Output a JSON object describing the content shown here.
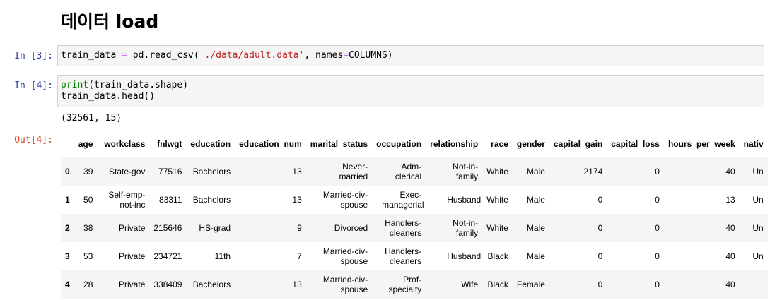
{
  "heading": "데이터 load",
  "cells": [
    {
      "prompt": "In [3]:",
      "code_parts": {
        "a": "train_data ",
        "eq": "=",
        "b": " pd.read_csv(",
        "str": "'./data/adult.data'",
        "c": ", names",
        "eq2": "=",
        "d": "COLUMNS)"
      }
    },
    {
      "prompt": "In [4]:",
      "code_parts": {
        "kw": "print",
        "a": "(train_data.shape)",
        "b": "train_data.head()"
      },
      "stdout": "(32561, 15)",
      "out_prompt": "Out[4]:"
    }
  ],
  "dataframe": {
    "columns": [
      "",
      "age",
      "workclass",
      "fnlwgt",
      "education",
      "education_num",
      "marital_status",
      "occupation",
      "relationship",
      "race",
      "gender",
      "capital_gain",
      "capital_loss",
      "hours_per_week",
      "nativ"
    ],
    "rows": [
      {
        "index": "0",
        "age": "39",
        "workclass": "State-gov",
        "fnlwgt": "77516",
        "education": "Bachelors",
        "education_num": "13",
        "marital_status": "Never-married",
        "occupation": "Adm-clerical",
        "relationship": "Not-in-family",
        "race": "White",
        "gender": "Male",
        "capital_gain": "2174",
        "capital_loss": "0",
        "hours_per_week": "40",
        "native": "Un"
      },
      {
        "index": "1",
        "age": "50",
        "workclass": "Self-emp-not-inc",
        "fnlwgt": "83311",
        "education": "Bachelors",
        "education_num": "13",
        "marital_status": "Married-civ-spouse",
        "occupation": "Exec-managerial",
        "relationship": "Husband",
        "race": "White",
        "gender": "Male",
        "capital_gain": "0",
        "capital_loss": "0",
        "hours_per_week": "13",
        "native": "Un"
      },
      {
        "index": "2",
        "age": "38",
        "workclass": "Private",
        "fnlwgt": "215646",
        "education": "HS-grad",
        "education_num": "9",
        "marital_status": "Divorced",
        "occupation": "Handlers-cleaners",
        "relationship": "Not-in-family",
        "race": "White",
        "gender": "Male",
        "capital_gain": "0",
        "capital_loss": "0",
        "hours_per_week": "40",
        "native": "Un"
      },
      {
        "index": "3",
        "age": "53",
        "workclass": "Private",
        "fnlwgt": "234721",
        "education": "11th",
        "education_num": "7",
        "marital_status": "Married-civ-spouse",
        "occupation": "Handlers-cleaners",
        "relationship": "Husband",
        "race": "Black",
        "gender": "Male",
        "capital_gain": "0",
        "capital_loss": "0",
        "hours_per_week": "40",
        "native": "Un"
      },
      {
        "index": "4",
        "age": "28",
        "workclass": "Private",
        "fnlwgt": "338409",
        "education": "Bachelors",
        "education_num": "13",
        "marital_status": "Married-civ-spouse",
        "occupation": "Prof-specialty",
        "relationship": "Wife",
        "race": "Black",
        "gender": "Female",
        "capital_gain": "0",
        "capital_loss": "0",
        "hours_per_week": "40",
        "native": ""
      }
    ]
  },
  "colors": {
    "in_prompt": "#303f9f",
    "out_prompt": "#d84315",
    "keyword": "#008000",
    "operator": "#aa22ff",
    "string": "#ba2121",
    "cell_bg": "#f5f5f5",
    "cell_border": "#cfcfcf"
  }
}
